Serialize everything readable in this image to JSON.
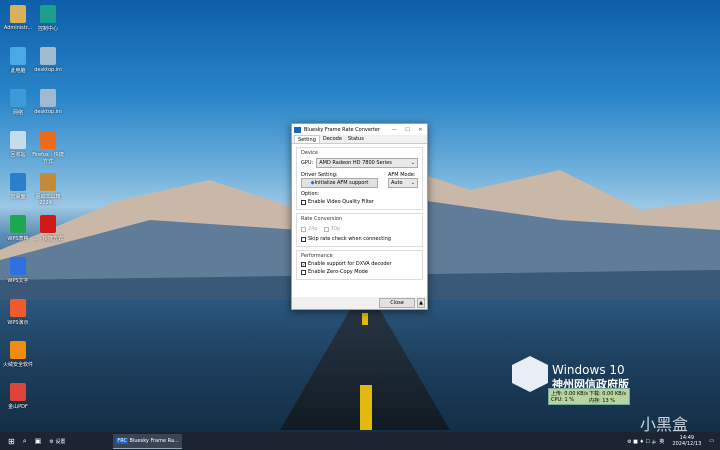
{
  "desktop": {
    "icons": [
      {
        "label": "Administr...",
        "color": "#d9b15a"
      },
      {
        "label": "控制中心",
        "color": "#1a9f8c"
      },
      {
        "label": "此电脑",
        "color": "#4aa8e8"
      },
      {
        "label": "desktop.ini",
        "color": "#9fb9cf"
      },
      {
        "label": "网络",
        "color": "#3c9ad8"
      },
      {
        "label": "desktop.ini",
        "color": "#9fb9cf"
      },
      {
        "label": "回收站",
        "color": "#c7dbea"
      },
      {
        "label": "Firefox - 快捷方式",
        "color": "#f06a1c"
      },
      {
        "label": "云桌面",
        "color": "#2b7fc9"
      },
      {
        "label": "驱动工具箱 2024...",
        "color": "#c28a3a"
      },
      {
        "label": "WPS表格",
        "color": "#1ea650"
      },
      {
        "label": "... - 快捷方式",
        "color": "#d01a1a"
      },
      {
        "label": "WPS文字",
        "color": "#2f6fe0"
      },
      {
        "label": "WPS演示",
        "color": "#ef5b2d"
      },
      {
        "label": "火绒安全软件",
        "color": "#f08c10"
      },
      {
        "label": "金山PDF",
        "color": "#e0433a"
      }
    ]
  },
  "dialog": {
    "title": "Bluesky Frame Rate Converter",
    "tabs": [
      "Setting",
      "Decode",
      "Status"
    ],
    "device": {
      "group": "Device",
      "gpu_label": "GPU:",
      "gpu_value": "AMD Radeon HD 7800 Series",
      "driver_label": "Driver Setting:",
      "init_button": "Initialize AFM support",
      "afm_label": "AFM Mode:",
      "afm_value": "Auto",
      "option_label": "Option:",
      "vqf": "Enable Video Quality Filter"
    },
    "rate": {
      "group": "Rate Conversion",
      "r24": "24p",
      "r30": "30p",
      "skip": "Skip rate check when connecting"
    },
    "perf": {
      "group": "Performance",
      "dxva": "Enable support for DXVA decoder",
      "zerocopy": "Enable Zero-Copy Mode"
    },
    "close": "Close"
  },
  "watermark": {
    "line1": "Windows 10",
    "line2": "神州网信政府版"
  },
  "netmon": {
    "up": "上传: 0.00 KB/s",
    "down": "下载: 0.00 KB/s",
    "cpu": "CPU: 1 %",
    "mem": "内存: 13 %"
  },
  "brand": "小黑盒",
  "taskbar": {
    "settings": "设置",
    "app": "Bluesky Frame Ra...",
    "time": "14:49",
    "date": "2024/12/13"
  }
}
